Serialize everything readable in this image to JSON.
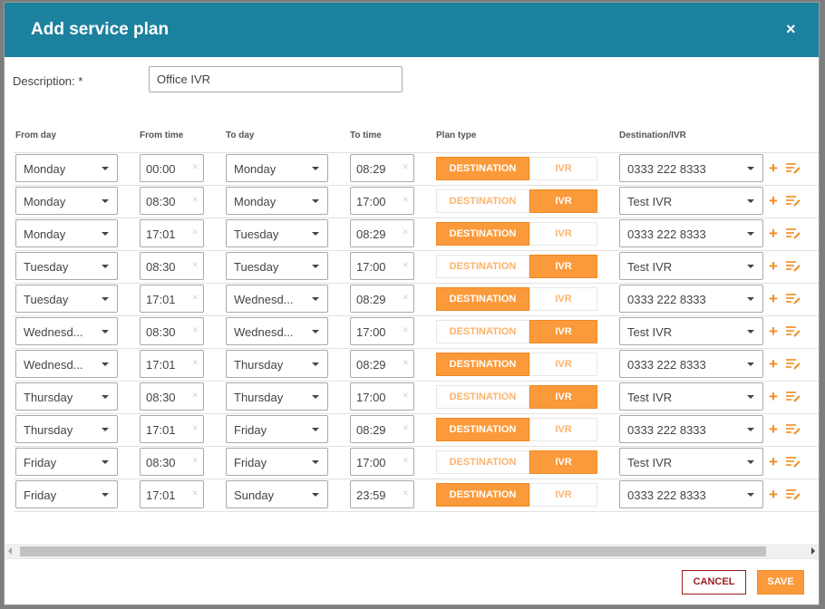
{
  "dialog": {
    "title": "Add service plan",
    "close_glyph": "×"
  },
  "description": {
    "label": "Description: *",
    "value": "Office IVR"
  },
  "columns": {
    "from_day": "From day",
    "from_time": "From time",
    "to_day": "To day",
    "to_time": "To time",
    "plan_type": "Plan type",
    "destination": "Destination/IVR"
  },
  "plan_type_options": {
    "destination": "DESTINATION",
    "ivr": "IVR"
  },
  "rows": [
    {
      "from_day": "Monday",
      "from_time": "00:00",
      "to_day": "Monday",
      "to_time": "08:29",
      "plan_type": "DESTINATION",
      "destination": "0333 222 8333"
    },
    {
      "from_day": "Monday",
      "from_time": "08:30",
      "to_day": "Monday",
      "to_time": "17:00",
      "plan_type": "IVR",
      "destination": "Test IVR"
    },
    {
      "from_day": "Monday",
      "from_time": "17:01",
      "to_day": "Tuesday",
      "to_time": "08:29",
      "plan_type": "DESTINATION",
      "destination": "0333 222 8333"
    },
    {
      "from_day": "Tuesday",
      "from_time": "08:30",
      "to_day": "Tuesday",
      "to_time": "17:00",
      "plan_type": "IVR",
      "destination": "Test IVR"
    },
    {
      "from_day": "Tuesday",
      "from_time": "17:01",
      "to_day": "Wednesd...",
      "to_time": "08:29",
      "plan_type": "DESTINATION",
      "destination": "0333 222 8333"
    },
    {
      "from_day": "Wednesd...",
      "from_time": "08:30",
      "to_day": "Wednesd...",
      "to_time": "17:00",
      "plan_type": "IVR",
      "destination": "Test IVR"
    },
    {
      "from_day": "Wednesd...",
      "from_time": "17:01",
      "to_day": "Thursday",
      "to_time": "08:29",
      "plan_type": "DESTINATION",
      "destination": "0333 222 8333"
    },
    {
      "from_day": "Thursday",
      "from_time": "08:30",
      "to_day": "Thursday",
      "to_time": "17:00",
      "plan_type": "IVR",
      "destination": "Test IVR"
    },
    {
      "from_day": "Thursday",
      "from_time": "17:01",
      "to_day": "Friday",
      "to_time": "08:29",
      "plan_type": "DESTINATION",
      "destination": "0333 222 8333"
    },
    {
      "from_day": "Friday",
      "from_time": "08:30",
      "to_day": "Friday",
      "to_time": "17:00",
      "plan_type": "IVR",
      "destination": "Test IVR"
    },
    {
      "from_day": "Friday",
      "from_time": "17:01",
      "to_day": "Sunday",
      "to_time": "23:59",
      "plan_type": "DESTINATION",
      "destination": "0333 222 8333"
    }
  ],
  "row_icons": {
    "add": "plus-icon",
    "edit": "edit-list-icon",
    "clear": "clear-x-icon"
  },
  "footer": {
    "cancel_label": "CANCEL",
    "save_label": "SAVE"
  },
  "colors": {
    "header": "#1c819e",
    "accent": "#fb9a3a",
    "cancel": "#9b1c1c"
  }
}
